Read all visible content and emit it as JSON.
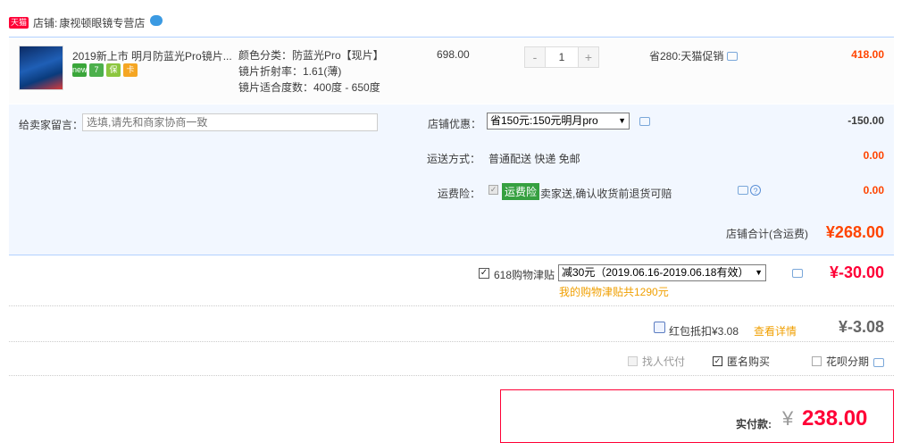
{
  "store": {
    "tag": "天猫",
    "label": "店铺:",
    "name": "康视顿眼镜专营店"
  },
  "item": {
    "title": "2019新上市 明月防蓝光Pro镜片...",
    "sku": [
      "颜色分类：防蓝光Pro【现片】",
      "镜片折射率：1.61(薄)",
      "镜片适合度数：400度 - 650度"
    ],
    "badges": [
      "new",
      "7",
      "保",
      "卡"
    ],
    "price": "698.00",
    "qty": {
      "minus": "-",
      "value": "1",
      "plus": "+"
    },
    "save": "省280:天猫促销",
    "sum": "418.00"
  },
  "message": {
    "label": "给卖家留言：",
    "placeholder": "选填,请先和商家协商一致"
  },
  "discount": {
    "label": "店铺优惠：",
    "selected": "省150元:150元明月pro",
    "amount": "-150.00"
  },
  "shipping": {
    "label": "运送方式：",
    "value": "普通配送 快递 免邮",
    "amount": "0.00"
  },
  "insurance": {
    "label": "运费险：",
    "tag": "运费险",
    "text": "卖家送,确认收货前退货可赔",
    "amount": "0.00"
  },
  "subtotal": {
    "label": "店铺合计(含运费)",
    "amount": "¥268.00"
  },
  "coupon618": {
    "label": "618购物津贴",
    "selected": "减30元（2019.06.16-2019.06.18有效）",
    "amount": "¥-30.00",
    "note": "我的购物津贴共1290元"
  },
  "redpacket": {
    "label": "红包抵扣¥3.08",
    "detail": "查看详情",
    "amount": "¥-3.08"
  },
  "options": {
    "proxy": "找人代付",
    "anonymous": "匿名购买",
    "installment": "花呗分期"
  },
  "payment": {
    "label": "实付款:",
    "yen": "¥",
    "amount": "238.00"
  }
}
